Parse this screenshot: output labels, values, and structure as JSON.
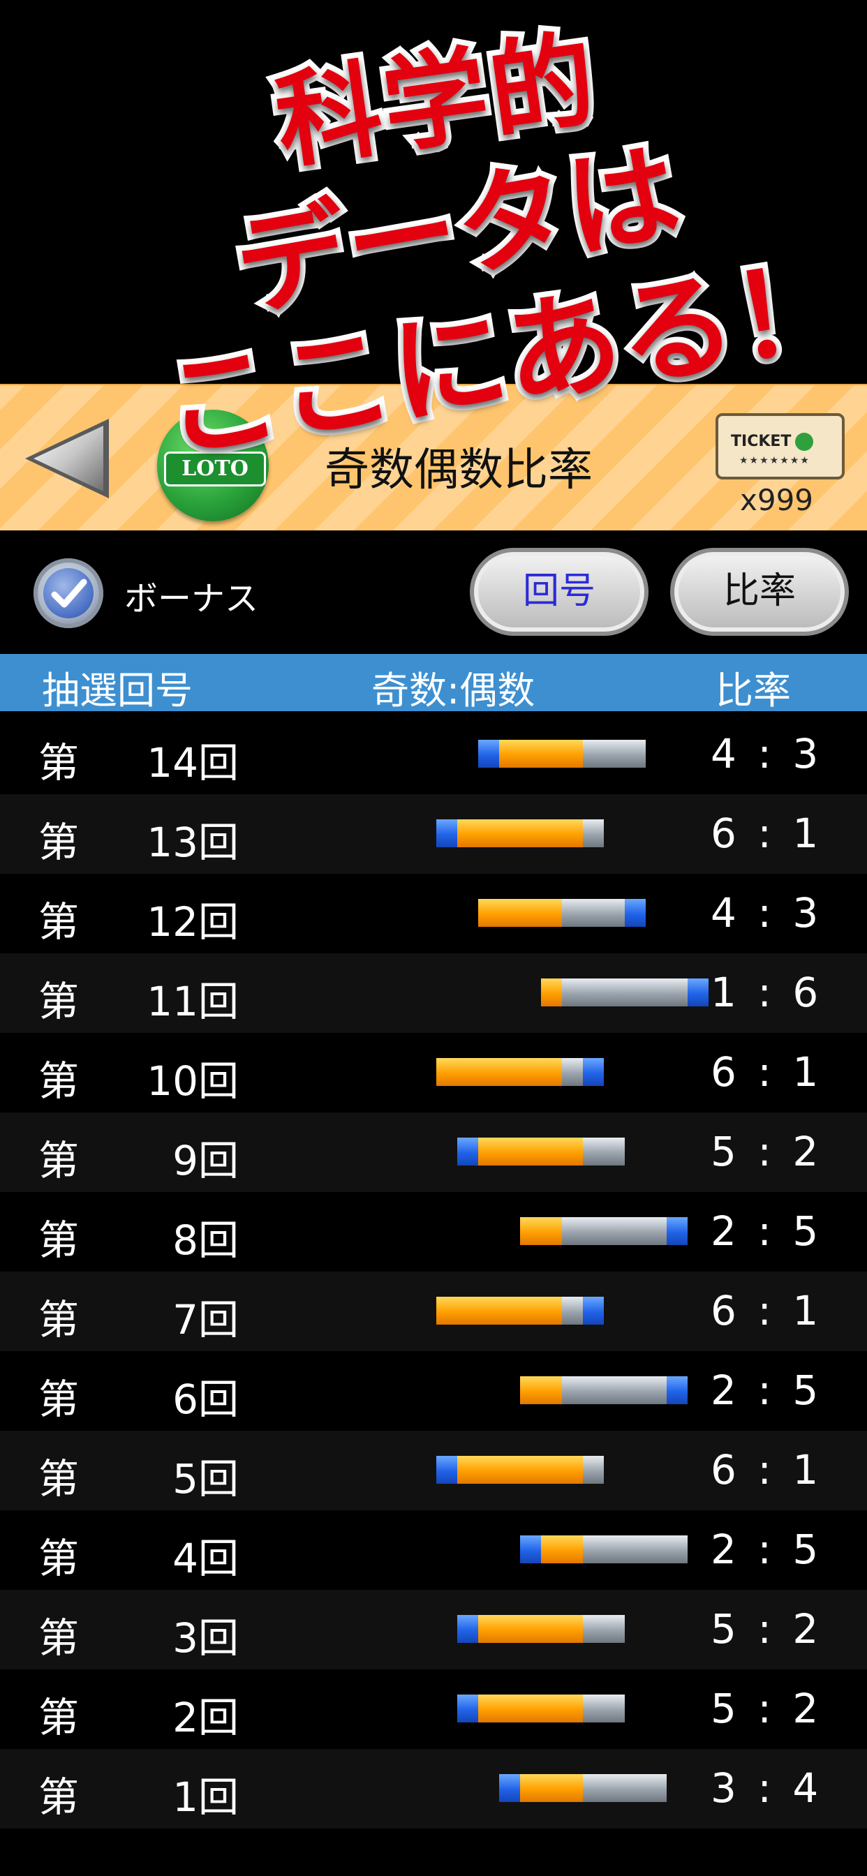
{
  "promo": {
    "line1": "科学的",
    "line2": "データは",
    "line3": "ここにある！"
  },
  "header": {
    "logo_text": "LOTO",
    "title": "奇数偶数比率",
    "ticket_label": "TICKET",
    "ticket_stars": "★★★★★★★",
    "ticket_count": "x999"
  },
  "controls": {
    "bonus_label": "ボーナス",
    "bonus_checked": true,
    "round_button": "回号",
    "ratio_button": "比率"
  },
  "table": {
    "headers": [
      "抽選回号",
      "奇数:偶数",
      "比率"
    ],
    "row_prefix": "第",
    "rows": [
      {
        "num": "14回",
        "ratio": "4 : 3",
        "odd": 4,
        "even": 3,
        "bonus": "odd"
      },
      {
        "num": "13回",
        "ratio": "6 : 1",
        "odd": 6,
        "even": 1,
        "bonus": "odd"
      },
      {
        "num": "12回",
        "ratio": "4 : 3",
        "odd": 4,
        "even": 3,
        "bonus": "even"
      },
      {
        "num": "11回",
        "ratio": "1 : 6",
        "odd": 1,
        "even": 6,
        "bonus": "even"
      },
      {
        "num": "10回",
        "ratio": "6 : 1",
        "odd": 6,
        "even": 1,
        "bonus": "even"
      },
      {
        "num": "9回",
        "ratio": "5 : 2",
        "odd": 5,
        "even": 2,
        "bonus": "odd"
      },
      {
        "num": "8回",
        "ratio": "2 : 5",
        "odd": 2,
        "even": 5,
        "bonus": "even"
      },
      {
        "num": "7回",
        "ratio": "6 : 1",
        "odd": 6,
        "even": 1,
        "bonus": "even"
      },
      {
        "num": "6回",
        "ratio": "2 : 5",
        "odd": 2,
        "even": 5,
        "bonus": "even"
      },
      {
        "num": "5回",
        "ratio": "6 : 1",
        "odd": 6,
        "even": 1,
        "bonus": "odd"
      },
      {
        "num": "4回",
        "ratio": "2 : 5",
        "odd": 2,
        "even": 5,
        "bonus": "odd"
      },
      {
        "num": "3回",
        "ratio": "5 : 2",
        "odd": 5,
        "even": 2,
        "bonus": "odd"
      },
      {
        "num": "2回",
        "ratio": "5 : 2",
        "odd": 5,
        "even": 2,
        "bonus": "odd"
      },
      {
        "num": "1回",
        "ratio": "3 : 4",
        "odd": 3,
        "even": 4,
        "bonus": "odd"
      }
    ]
  },
  "colors": {
    "header_bg": "#ffc56e",
    "table_head_bg": "#3d8fd0",
    "odd_bar": "#ff9f00",
    "even_bar": "#9ba4ad",
    "bonus_bar": "#2163e8",
    "promo_text": "#e3000f"
  },
  "icons": {
    "back": "triangle-left-icon",
    "check": "checkmark-icon",
    "ticket": "ticket-icon"
  }
}
